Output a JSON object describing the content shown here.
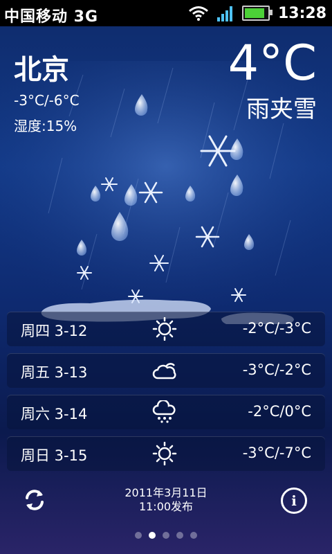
{
  "statusbar": {
    "carrier": "中国移动 3G",
    "time": "13:28"
  },
  "current": {
    "city": "北京",
    "range": "-3°C/-6°C",
    "humidity": "湿度:15%",
    "temp": "4°C",
    "condition": "雨夹雪"
  },
  "forecast": [
    {
      "day": "周四 3-12",
      "icon": "sunny-icon",
      "temps": "-2°C/-3°C"
    },
    {
      "day": "周五 3-13",
      "icon": "cloudy-icon",
      "temps": "-3°C/-2°C"
    },
    {
      "day": "周六 3-14",
      "icon": "snow-cloud-icon",
      "temps": "-2°C/0°C"
    },
    {
      "day": "周日 3-15",
      "icon": "sunny-icon",
      "temps": "-3°C/-7°C"
    }
  ],
  "footer": {
    "published_date": "2011年3月11日",
    "published_time": "11:00发布"
  },
  "pager": {
    "count": 5,
    "active": 1
  }
}
